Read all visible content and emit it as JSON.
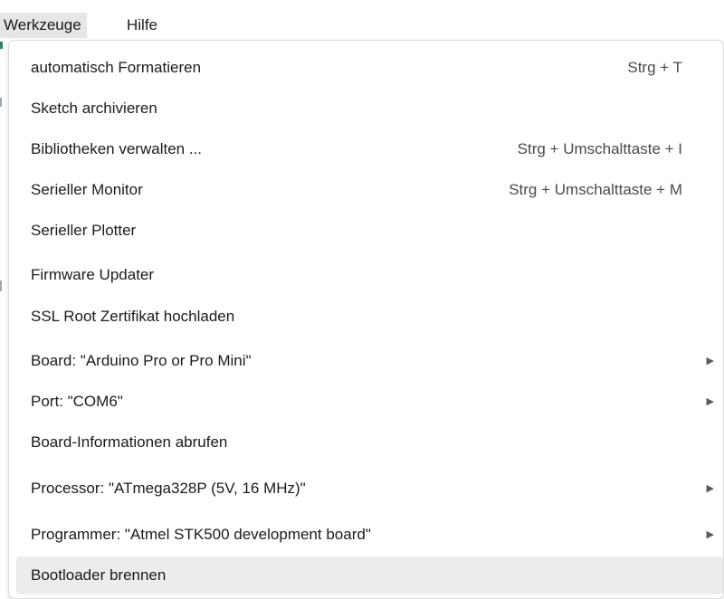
{
  "menubar": {
    "items": [
      {
        "label": "Werkzeuge",
        "active": true
      },
      {
        "label": "Hilfe",
        "active": false
      }
    ]
  },
  "menu": {
    "items": [
      {
        "label": "automatisch Formatieren",
        "shortcut": "Strg + T",
        "submenu": false
      },
      {
        "label": "Sketch archivieren",
        "shortcut": "",
        "submenu": false
      },
      {
        "label": "Bibliotheken verwalten ...",
        "shortcut": "Strg + Umschalttaste + I",
        "submenu": false
      },
      {
        "label": "Serieller Monitor",
        "shortcut": "Strg + Umschalttaste + M",
        "submenu": false
      },
      {
        "label": "Serieller Plotter",
        "shortcut": "",
        "submenu": false
      },
      {
        "label": "Firmware Updater",
        "shortcut": "",
        "submenu": false
      },
      {
        "label": "SSL Root Zertifikat hochladen",
        "shortcut": "",
        "submenu": false
      },
      {
        "label": "Board: \"Arduino Pro or Pro Mini\"",
        "shortcut": "",
        "submenu": true
      },
      {
        "label": "Port: \"COM6\"",
        "shortcut": "",
        "submenu": true
      },
      {
        "label": "Board-Informationen abrufen",
        "shortcut": "",
        "submenu": false
      },
      {
        "label": "Processor: \"ATmega328P (5V, 16 MHz)\"",
        "shortcut": "",
        "submenu": true
      },
      {
        "label": "Programmer: \"Atmel STK500 development board\"",
        "shortcut": "",
        "submenu": true
      },
      {
        "label": "Bootloader brennen",
        "shortcut": "",
        "submenu": false,
        "highlighted": true
      }
    ],
    "submenu_arrow_glyph": "▶"
  },
  "colors": {
    "highlight": "#ececec",
    "menubar_active": "#e6e6e6",
    "text": "#1b1b1b"
  }
}
